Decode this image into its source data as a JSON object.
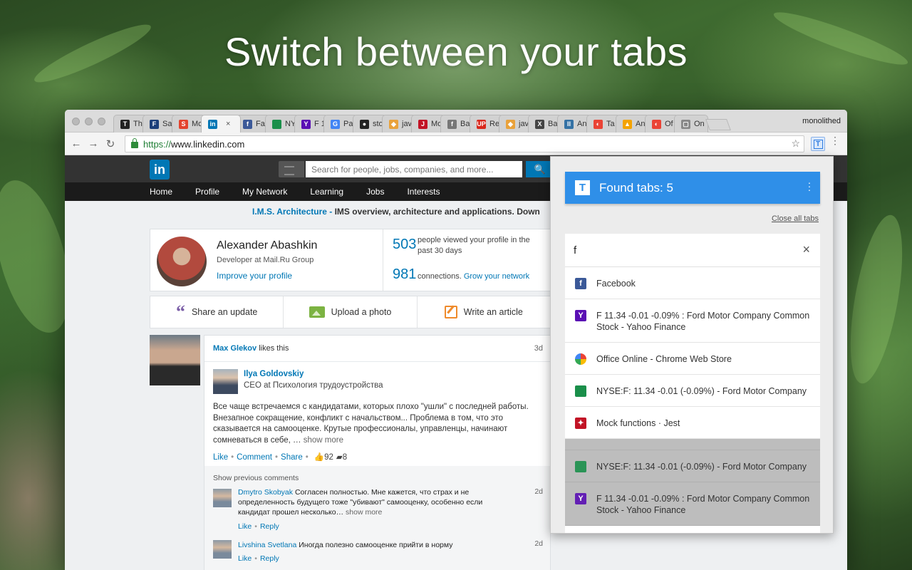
{
  "headline": "Switch between your tabs",
  "browser": {
    "tabs": [
      {
        "label": "Th",
        "fav": "T",
        "color": "#222"
      },
      {
        "label": "Sa",
        "fav": "F",
        "color": "#1c3f7a"
      },
      {
        "label": "Mc",
        "fav": "S",
        "color": "#e4432d"
      },
      {
        "label": "",
        "fav": "in",
        "color": "#0077b5",
        "active": true
      },
      {
        "label": "Fa",
        "fav": "f",
        "color": "#3b5998"
      },
      {
        "label": "NY",
        "fav": "",
        "color": "#1a8f4a"
      },
      {
        "label": "F 1",
        "fav": "Y",
        "color": "#5a0fb4"
      },
      {
        "label": "Pa",
        "fav": "G",
        "color": "#4285f4"
      },
      {
        "label": "sto",
        "fav": "●",
        "color": "#222"
      },
      {
        "label": "jav",
        "fav": "◆",
        "color": "#e9a23b"
      },
      {
        "label": "Mo",
        "fav": "J",
        "color": "#c21325"
      },
      {
        "label": "Ba",
        "fav": "f",
        "color": "#777"
      },
      {
        "label": "Re",
        "fav": "UP",
        "color": "#d9281c"
      },
      {
        "label": "jav",
        "fav": "◆",
        "color": "#e9a23b"
      },
      {
        "label": "Ba",
        "fav": "X",
        "color": "#444"
      },
      {
        "label": "An",
        "fav": "II",
        "color": "#3572a5"
      },
      {
        "label": "Ta",
        "fav": "◐",
        "color": "#ea4335"
      },
      {
        "label": "An",
        "fav": "▲",
        "color": "#f4a300"
      },
      {
        "label": "Of",
        "fav": "◐",
        "color": "#ea4335"
      },
      {
        "label": "On",
        "fav": "▢",
        "color": "#888"
      }
    ],
    "active_tab_close": "×",
    "profile_name": "monolithed",
    "nav": {
      "back": "←",
      "forward": "→",
      "reload": "↻"
    },
    "url_scheme": "https://",
    "url_host": "www.linkedin.com",
    "star": "☆",
    "extension_letter": "T",
    "menu": "⋮"
  },
  "linkedin": {
    "logo": "in",
    "search_placeholder": "Search for people, jobs, companies, and more...",
    "search_icon": "🔍",
    "nav": [
      "Home",
      "Profile",
      "My Network",
      "Learning",
      "Jobs",
      "Interests"
    ],
    "announce_link": "I.M.S. Architecture -",
    "announce_text": " IMS overview, architecture and applications. Down",
    "profile": {
      "name": "Alexander Abashkin",
      "title": "Developer at Mail.Ru Group",
      "improve": "Improve your profile",
      "views_num": "503",
      "views_txt1": "people viewed your profile in the",
      "views_txt2": "past 30 days",
      "conn_num": "981",
      "conn_txt": "connections.",
      "conn_link": "Grow your network"
    },
    "share": {
      "update": "Share an update",
      "photo": "Upload a photo",
      "article": "Write an article"
    },
    "feed": {
      "liker": "Max Glekov",
      "likes_this": " likes this",
      "time": "3d",
      "author": "Ilya Goldovskiy",
      "author_title": "CEO at Психология трудоустройства",
      "text": "Все чаще встречаемся с кандидатами, которых плохо \"ушли\" с последней работы. Внезапное сокращение, конфликт с начальством... Проблема в том, что это сказывается на самооценке. Крутые профессионалы, управленцы, начинают сомневаться в себе, … ",
      "show_more": "show more",
      "like": "Like",
      "comment": "Comment",
      "share": "Share",
      "likes_count": "92",
      "comments_count": "8",
      "show_previous": "Show previous comments",
      "c1_who": "Dmytro Skobyak",
      "c1_text": " Согласен полностью. Мне кажется, что страх и не определенность будущего тоже \"убивают\" самооценку, особенно если кандидат прошел несколько… ",
      "c1_time": "2d",
      "c2_who": "Livshina Svetlana",
      "c2_text": " Иногда полезно самооценке прийти в норму",
      "c2_time": "2d",
      "reply": "Reply"
    }
  },
  "popup": {
    "title": "Found tabs: 5",
    "close_all": "Close all tabs",
    "query": "f",
    "clear": "×",
    "results": [
      {
        "title": "Facebook",
        "fav": "f",
        "cls": "fav-fb"
      },
      {
        "title": "F 11.34 -0.01 -0.09% : Ford Motor Company Common Stock - Yahoo Finance",
        "fav": "Y",
        "cls": "fav-y"
      },
      {
        "title": "Office Online - Chrome Web Store",
        "fav": "",
        "cls": "fav-office"
      },
      {
        "title": "NYSE:F: 11.34 -0.01 (-0.09%) - Ford Motor Company",
        "fav": "",
        "cls": "fav-nyse"
      },
      {
        "title": "Mock functions · Jest",
        "fav": "✦",
        "cls": "fav-jest"
      }
    ],
    "dimmed": [
      {
        "title": "NYSE:F: 11.34 -0.01 (-0.09%) - Ford Motor Company",
        "fav": "",
        "cls": "fav-nyse"
      },
      {
        "title": "F 11.34 -0.01 -0.09% : Ford Motor Company Common Stock - Yahoo Finance",
        "fav": "Y",
        "cls": "fav-y"
      }
    ]
  }
}
